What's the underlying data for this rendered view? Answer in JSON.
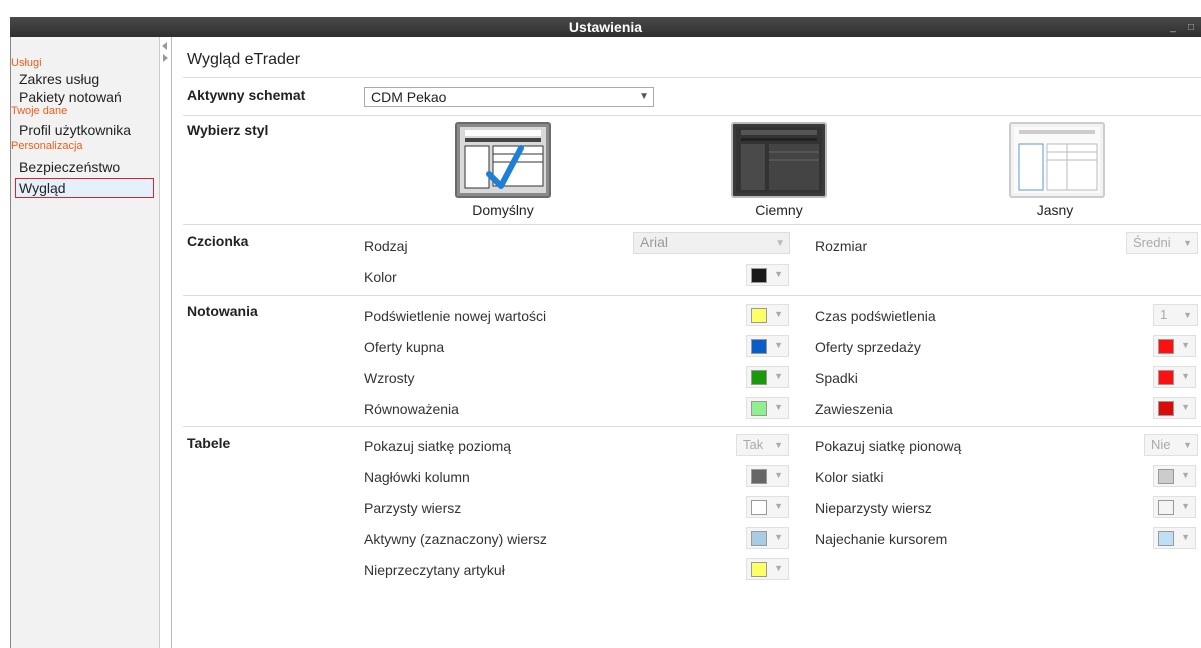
{
  "window": {
    "title": "Ustawienia",
    "min_icon": "minimize-icon",
    "max_icon": "maximize-icon"
  },
  "sidebar": {
    "sections": [
      {
        "title": "Usługi",
        "items": [
          "Zakres usług",
          "Pakiety notowań"
        ]
      },
      {
        "title": "Twoje dane",
        "items": [
          "Profil użytkownika"
        ]
      },
      {
        "title": "Personalizacja",
        "items": [
          "Bezpieczeństwo",
          "Wygląd"
        ]
      }
    ],
    "active": "Wygląd"
  },
  "main": {
    "heading": "Wygląd eTrader",
    "scheme": {
      "label": "Aktywny schemat",
      "value": "CDM Pekao"
    },
    "style": {
      "label": "Wybierz styl",
      "options": [
        {
          "name": "Domyślny",
          "selected": true
        },
        {
          "name": "Ciemny",
          "selected": false
        },
        {
          "name": "Jasny",
          "selected": false
        }
      ]
    },
    "font": {
      "label": "Czcionka",
      "type_label": "Rodzaj",
      "type_value": "Arial",
      "size_label": "Rozmiar",
      "size_value": "Średni",
      "color_label": "Kolor",
      "color_value": "#1a1a1a"
    },
    "quotes": {
      "label": "Notowania",
      "rows": [
        {
          "left": "Podświetlenie nowej wartości",
          "left_color": "#ffff66",
          "right": "Czas podświetlenia",
          "right_value": "1"
        },
        {
          "left": "Oferty kupna",
          "left_color": "#0a5cc8",
          "right": "Oferty sprzedaży",
          "right_color": "#ff1010"
        },
        {
          "left": "Wzrosty",
          "left_color": "#1a9a0a",
          "right": "Spadki",
          "right_color": "#ff1010"
        },
        {
          "left": "Równoważenia",
          "left_color": "#90f090",
          "right": "Zawieszenia",
          "right_color": "#dd0a0a"
        }
      ]
    },
    "tables": {
      "label": "Tabele",
      "rows": [
        {
          "left": "Pokazuj siatkę poziomą",
          "left_value": "Tak",
          "right": "Pokazuj siatkę pionową",
          "right_value": "Nie"
        },
        {
          "left": "Nagłówki kolumn",
          "left_color": "#666666",
          "right": "Kolor siatki",
          "right_color": "#cccccc"
        },
        {
          "left": "Parzysty wiersz",
          "left_color": "#ffffff",
          "right": "Nieparzysty wiersz",
          "right_color": "#f4f4f4"
        },
        {
          "left": "Aktywny (zaznaczony) wiersz",
          "left_color": "#a8cce4",
          "right": "Najechanie kursorem",
          "right_color": "#bfe0f4"
        },
        {
          "left": "Nieprzeczytany artykuł",
          "left_color": "#ffff66"
        }
      ]
    }
  }
}
